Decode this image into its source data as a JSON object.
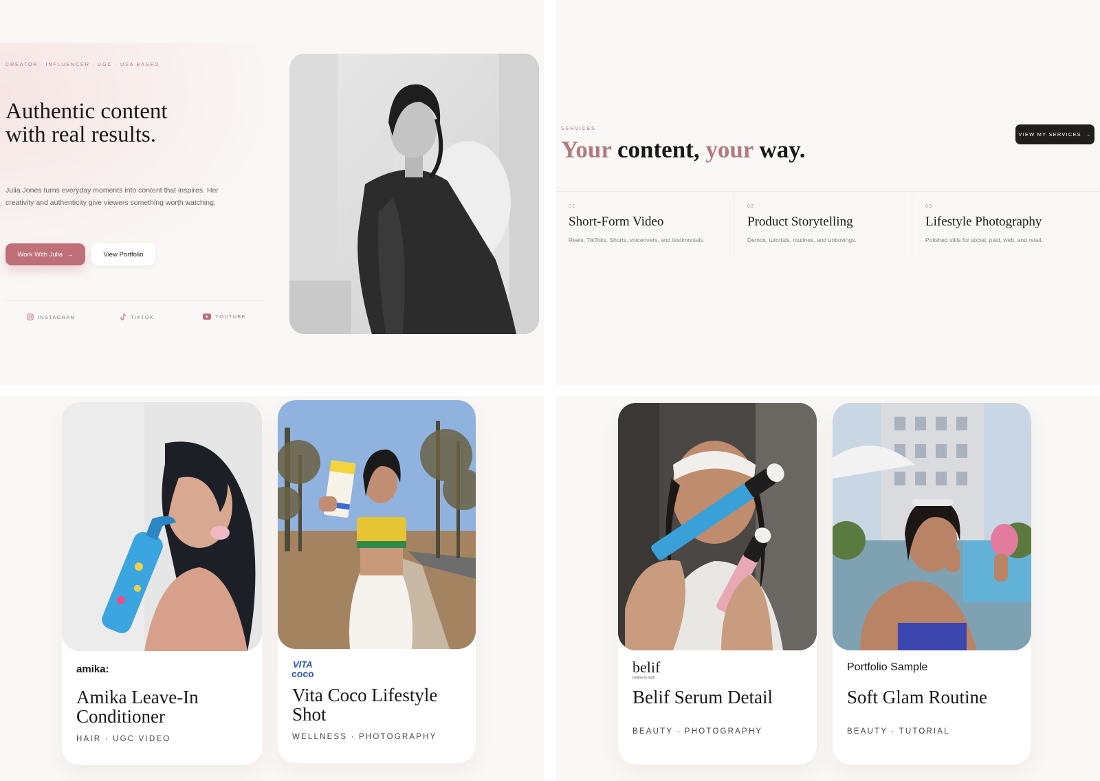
{
  "hero": {
    "eyebrow": "CREATOR · INFLUENCER · UGC · USA BASED",
    "title_line1": "Authentic content",
    "title_line2": "with real results.",
    "description": "Julia Jones turns everyday moments into content that inspires. Her creativity and authenticity give viewers something worth watching.",
    "primary_cta": "Work With Julia",
    "secondary_cta": "View Portfolio",
    "socials": [
      {
        "label": "INSTAGRAM",
        "icon": "instagram-icon"
      },
      {
        "label": "TIKTOK",
        "icon": "tiktok-icon"
      },
      {
        "label": "YOUTUBE",
        "icon": "youtube-icon"
      }
    ]
  },
  "services": {
    "eyebrow": "SERVICES",
    "title_part1": "Your",
    "title_part2": " content, ",
    "title_part3": "your",
    "title_part4": " way.",
    "cta": "VIEW MY SERVICES",
    "items": [
      {
        "num": "01",
        "name": "Short-Form Video",
        "desc": "Reels, TikToks, Shorts, voiceovers, and testimonials."
      },
      {
        "num": "02",
        "name": "Product Storytelling",
        "desc": "Demos, tutorials, routines, and unboxings."
      },
      {
        "num": "03",
        "name": "Lifestyle Photography",
        "desc": "Polished stills for social, paid, web, and retail."
      }
    ]
  },
  "portfolio": [
    {
      "brand": "amika:",
      "title": "Amika Leave-In Conditioner",
      "tags": "HAIR · UGC VIDEO"
    },
    {
      "brand": "VITA COCO",
      "title": "Vita Coco Lifestyle Shot",
      "tags": "WELLNESS · PHOTOGRAPHY"
    },
    {
      "brand": "belif",
      "brand_sub": "believe in truth",
      "title": "Belif Serum Detail",
      "tags": "BEAUTY · PHOTOGRAPHY"
    },
    {
      "brand": "Portfolio Sample",
      "title": "Soft Glam Routine",
      "tags": "BEAUTY · TUTORIAL"
    }
  ],
  "colors": {
    "accent": "#bf6f78",
    "accent_text": "#b27a7f",
    "dark_button": "#221d1d",
    "panel_bg": "#faf8f6"
  }
}
